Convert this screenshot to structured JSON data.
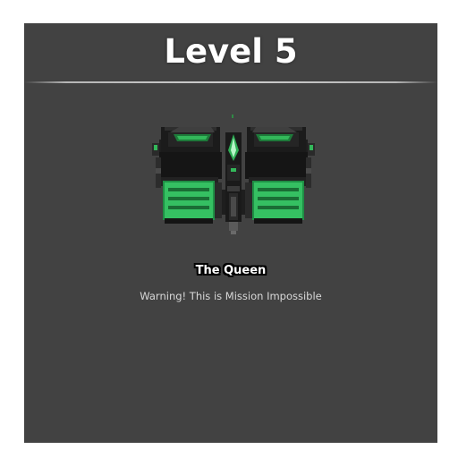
{
  "level": {
    "title": "Level 5"
  },
  "boss": {
    "name": "The Queen",
    "icon": "twin-pod-green-spaceship"
  },
  "message": {
    "warning": "Warning! This is Mission Impossible"
  },
  "colors": {
    "panel_background": "#424242",
    "page_background": "#ffffff",
    "title_text": "#ffffff",
    "warning_text": "#d8d8d8",
    "ship_green": "#33b85a",
    "ship_dark": "#1a1a1a"
  }
}
